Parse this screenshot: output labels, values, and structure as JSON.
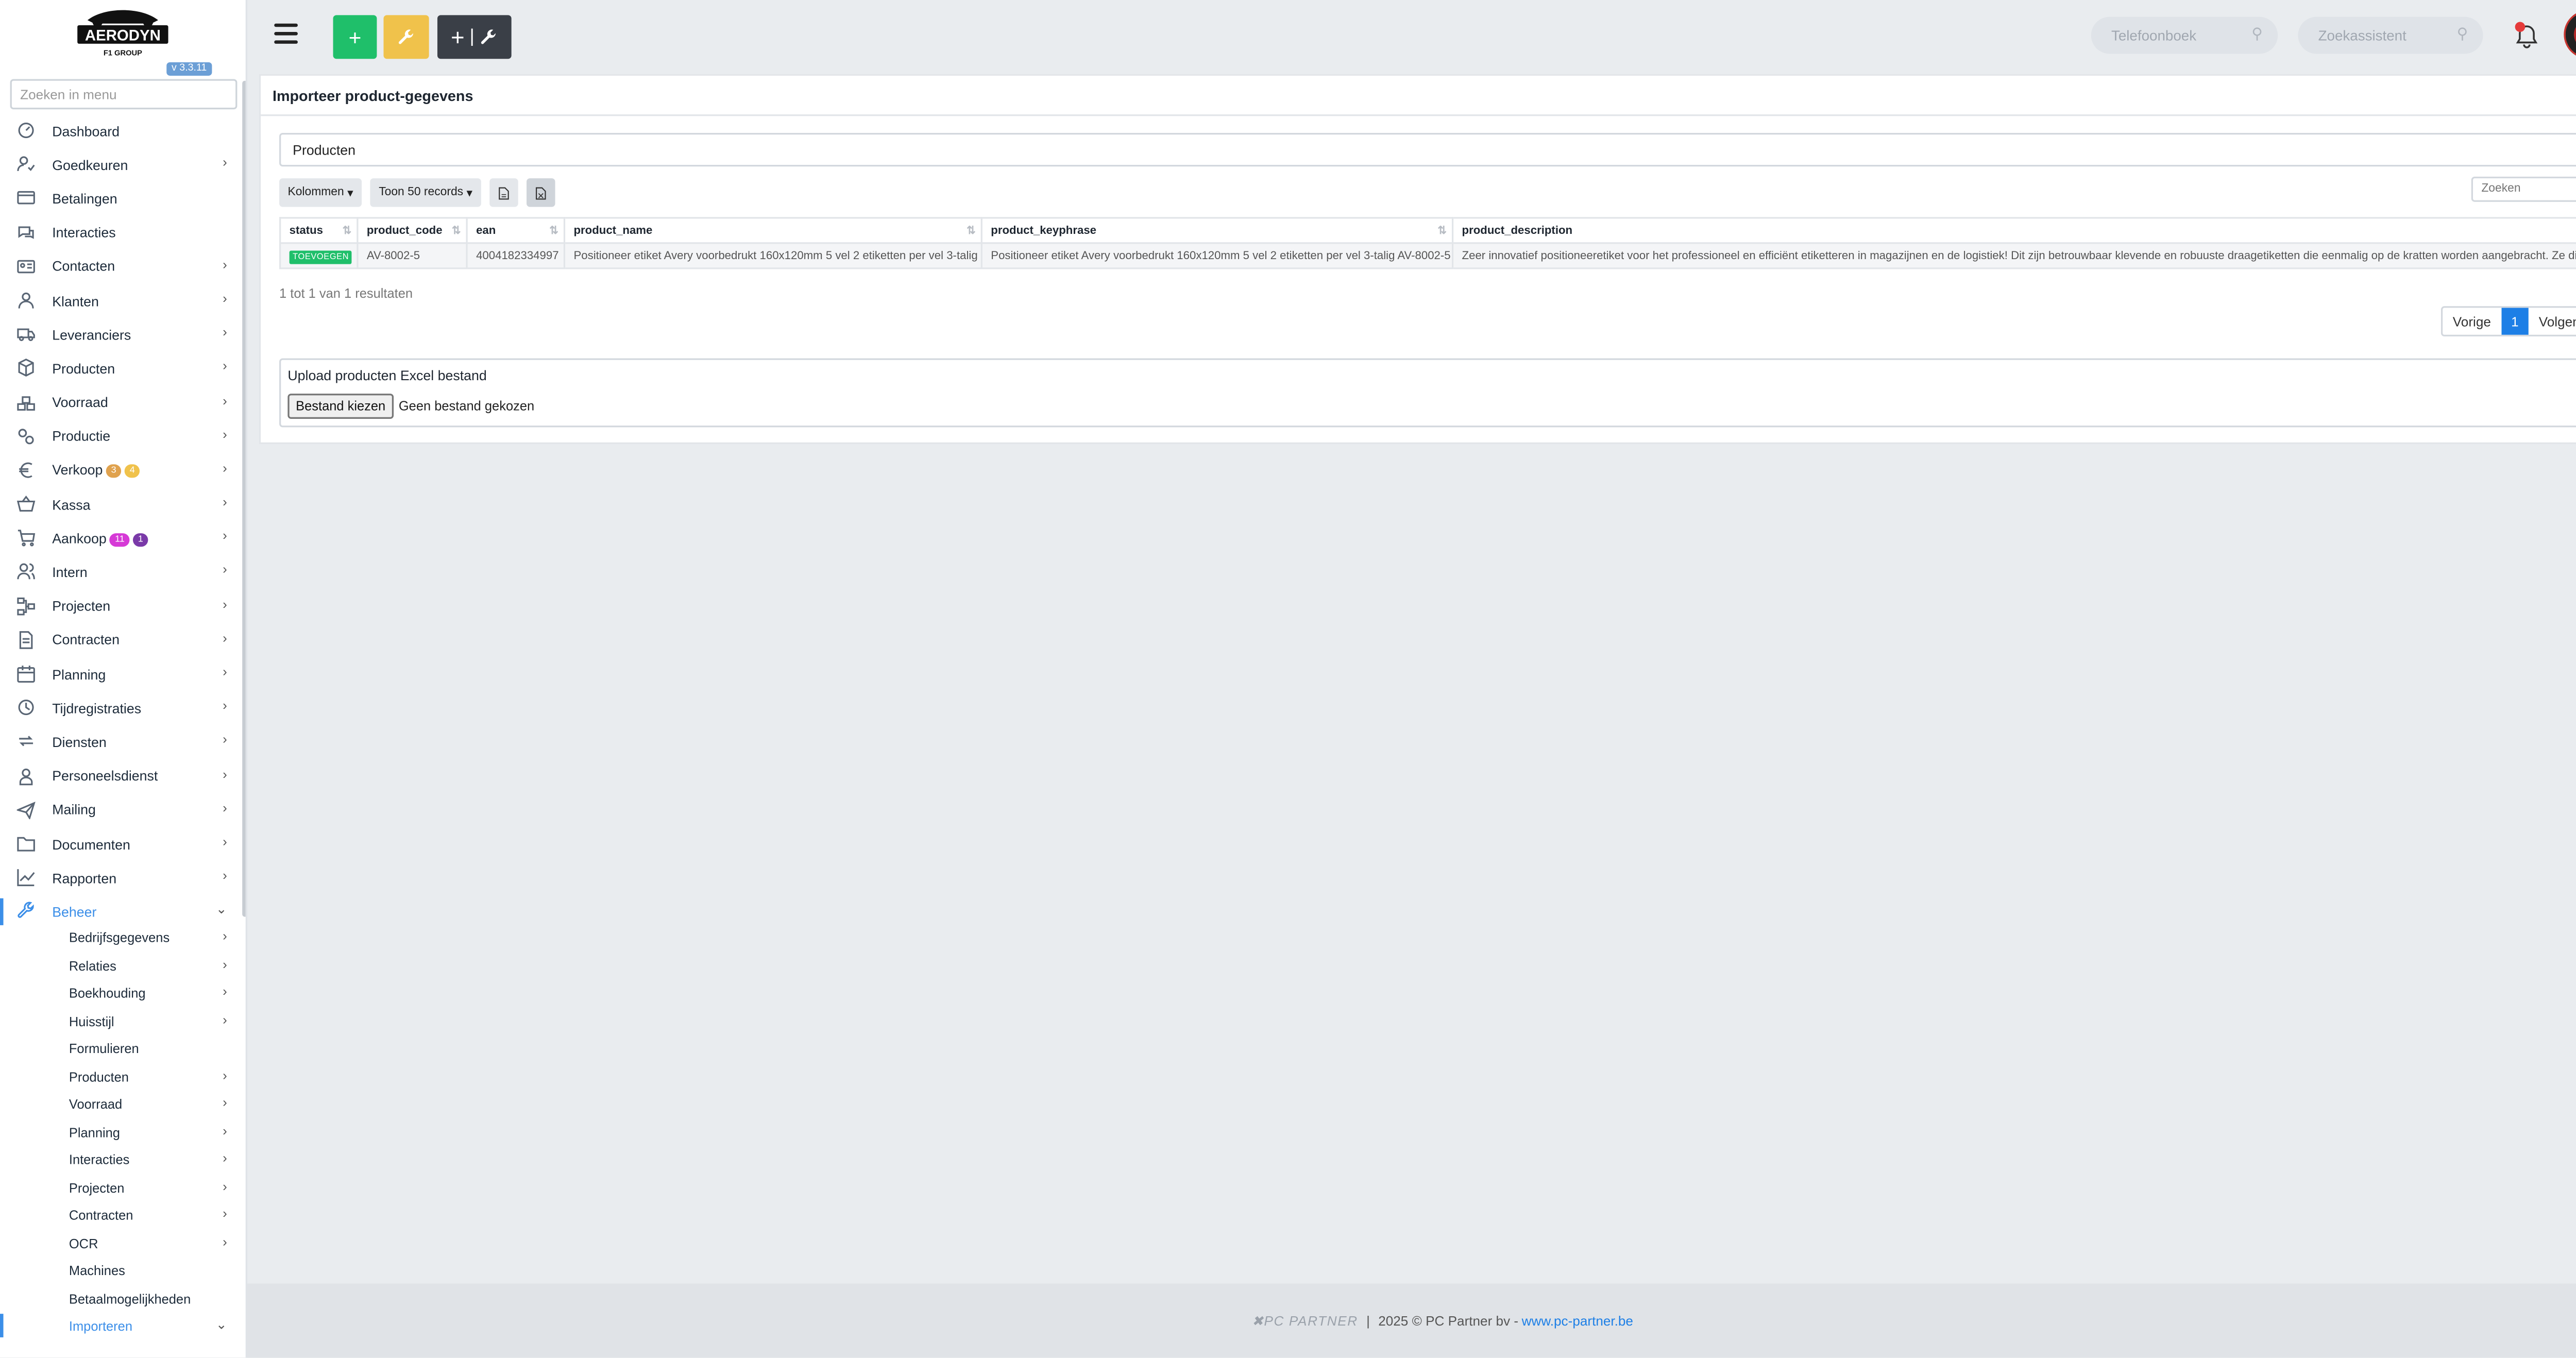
{
  "app": {
    "logo_text": "AERODYN",
    "logo_sub": "F1 GROUP",
    "version": "v 3.3.11",
    "menu_search_placeholder": "Zoeken in menu"
  },
  "sidebar": {
    "items": [
      {
        "label": "Dashboard",
        "icon": "dashboard-icon",
        "chevron": false
      },
      {
        "label": "Goedkeuren",
        "icon": "approve-icon",
        "chevron": true
      },
      {
        "label": "Betalingen",
        "icon": "payments-icon",
        "chevron": false
      },
      {
        "label": "Interacties",
        "icon": "chat-icon",
        "chevron": false
      },
      {
        "label": "Contacten",
        "icon": "contact-card-icon",
        "chevron": true
      },
      {
        "label": "Klanten",
        "icon": "customer-icon",
        "chevron": true
      },
      {
        "label": "Leveranciers",
        "icon": "truck-icon",
        "chevron": true
      },
      {
        "label": "Producten",
        "icon": "box-icon",
        "chevron": true
      },
      {
        "label": "Voorraad",
        "icon": "stock-icon",
        "chevron": true
      },
      {
        "label": "Productie",
        "icon": "gears-icon",
        "chevron": true
      },
      {
        "label": "Verkoop",
        "icon": "euro-icon",
        "chevron": true,
        "badges": [
          {
            "text": "3",
            "color": "#e0a24e"
          },
          {
            "text": "4",
            "color": "#f0c24b"
          }
        ]
      },
      {
        "label": "Kassa",
        "icon": "basket-icon",
        "chevron": true
      },
      {
        "label": "Aankoop",
        "icon": "cart-icon",
        "chevron": true,
        "badges": [
          {
            "text": "11",
            "color": "#d63ad6"
          },
          {
            "text": "1",
            "color": "#7a3aa8"
          }
        ]
      },
      {
        "label": "Intern",
        "icon": "users-icon",
        "chevron": true
      },
      {
        "label": "Projecten",
        "icon": "diagram-icon",
        "chevron": true
      },
      {
        "label": "Contracten",
        "icon": "contract-icon",
        "chevron": true
      },
      {
        "label": "Planning",
        "icon": "calendar-icon",
        "chevron": true
      },
      {
        "label": "Tijdregistraties",
        "icon": "clock-icon",
        "chevron": true
      },
      {
        "label": "Diensten",
        "icon": "repeat-icon",
        "chevron": true
      },
      {
        "label": "Personeelsdienst",
        "icon": "person-icon",
        "chevron": true
      },
      {
        "label": "Mailing",
        "icon": "paper-plane-icon",
        "chevron": true
      },
      {
        "label": "Documenten",
        "icon": "folder-icon",
        "chevron": true
      },
      {
        "label": "Rapporten",
        "icon": "chart-icon",
        "chevron": true
      },
      {
        "label": "Beheer",
        "icon": "wrench-icon",
        "chevron": true,
        "active": true
      }
    ],
    "sub_items": [
      {
        "label": "Bedrijfsgegevens",
        "chevron": true
      },
      {
        "label": "Relaties",
        "chevron": true
      },
      {
        "label": "Boekhouding",
        "chevron": true
      },
      {
        "label": "Huisstijl",
        "chevron": true
      },
      {
        "label": "Formulieren",
        "chevron": false
      },
      {
        "label": "Producten",
        "chevron": true
      },
      {
        "label": "Voorraad",
        "chevron": true
      },
      {
        "label": "Planning",
        "chevron": true
      },
      {
        "label": "Interacties",
        "chevron": true
      },
      {
        "label": "Projecten",
        "chevron": true
      },
      {
        "label": "Contracten",
        "chevron": true
      },
      {
        "label": "OCR",
        "chevron": true
      },
      {
        "label": "Machines",
        "chevron": false
      },
      {
        "label": "Betaalmogelijkheden",
        "chevron": false
      },
      {
        "label": "Importeren",
        "chevron": true,
        "active": true
      }
    ]
  },
  "topbar": {
    "search1_placeholder": "Telefoonboek",
    "search2_placeholder": "Zoekassistent"
  },
  "card": {
    "title": "Importeer product-gegevens",
    "select_value": "Producten",
    "columns_button": "Kolommen",
    "show_button": "Toon 50 records",
    "search_placeholder": "Zoeken",
    "table": {
      "headers": [
        "status",
        "product_code",
        "ean",
        "product_name",
        "product_keyphrase",
        "product_description"
      ],
      "rows": [
        {
          "status": "TOEVOEGEN",
          "product_code": "AV-8002-5",
          "ean": "4004182334997",
          "product_name": "Positioneer etiket Avery voorbedrukt 160x120mm 5 vel 2 etiketten per vel 3-talig",
          "product_keyphrase": "Positioneer etiket Avery voorbedrukt 160x120mm 5 vel 2 etiketten per vel 3-talig AV-8002-5",
          "product_description": "Zeer innovatief positioneeretiket voor het professioneel en efficiënt etiketteren in magazijnen en de logistiek! Dit zijn betrouwbaar klevende en robuuste draagetiketten die eenmalig op de kratten worden aangebracht. Ze dienen als"
        }
      ]
    },
    "info": "1 tot 1 van 1 resultaten",
    "pager": {
      "prev": "Vorige",
      "current": "1",
      "next": "Volgende"
    },
    "upload": {
      "title": "Upload producten Excel bestand",
      "button": "Bestand kiezen",
      "no_file": "Geen bestand gekozen"
    }
  },
  "footer": {
    "brand": "PC PARTNER",
    "separator": "|",
    "copyright": "2025 © PC Partner bv -",
    "link": "www.pc-partner.be"
  },
  "colors": {
    "accent": "#3b8ee8",
    "green": "#1fbf6a",
    "yellow": "#f0c24b",
    "dark": "#3a3f47"
  }
}
